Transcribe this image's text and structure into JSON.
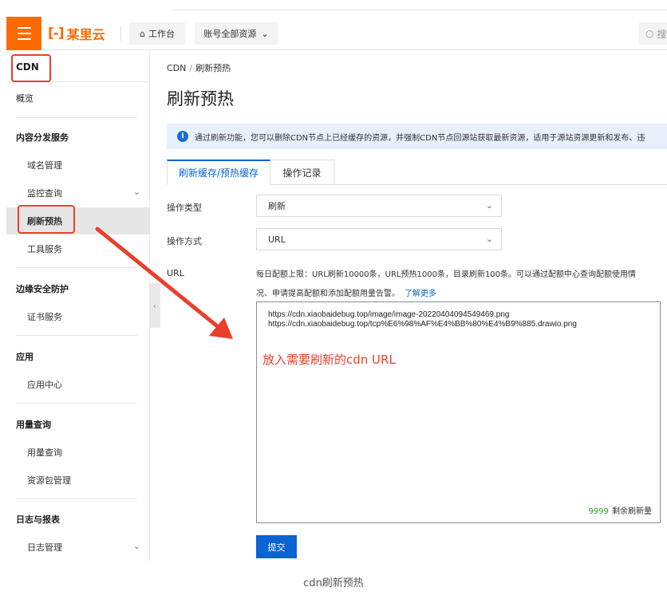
{
  "topbar": {
    "brand": "某里云",
    "brand_mark": "[-]",
    "workspace_label": "工作台",
    "resource_label": "账号全部资源",
    "search_placeholder": "搜"
  },
  "sidebar": {
    "title": "CDN",
    "overview": "概览",
    "groups": [
      {
        "label": "内容分发服务",
        "items": [
          "域名管理",
          "监控查询",
          "刷新预热",
          "工具服务"
        ]
      },
      {
        "label": "边缘安全防护",
        "items": [
          "证书服务"
        ]
      },
      {
        "label": "应用",
        "items": [
          "应用中心"
        ]
      },
      {
        "label": "用量查询",
        "items": [
          "用量查询",
          "资源包管理"
        ]
      },
      {
        "label": "日志与报表",
        "items": [
          "日志管理"
        ]
      }
    ]
  },
  "breadcrumb": {
    "root": "CDN",
    "separator": "/",
    "current": "刷新预热"
  },
  "page_title": "刷新预热",
  "notice": "通过刷新功能，您可以删除CDN节点上已经缓存的资源，并强制CDN节点回源站获取最新资源，适用于源站资源更新和发布、违",
  "tabs": [
    {
      "label": "刷新缓存/预热缓存",
      "active": true
    },
    {
      "label": "操作记录",
      "active": false
    }
  ],
  "form": {
    "op_type_label": "操作类型",
    "op_type_value": "刷新",
    "op_method_label": "操作方式",
    "op_method_value": "URL",
    "url_label": "URL",
    "hint_line1": "每日配额上限：URL刷新10000条，URL预热1000条，目录刷新100条。可以通过配额中心查询配额使用情",
    "hint_line2": "况、申请提高配额和添加配额用量告警。",
    "hint_link": "了解更多",
    "urls": [
      "https://cdn.xiaobaidebug.top/image/image-20220404094549469.png",
      "https://cdn.xiaobaidebug.top/tcp%E6%98%AF%E4%BB%80%E4%B9%885.drawio.png"
    ],
    "annotation": "放入需要刷新的cdn URL",
    "remaining_count": "9999",
    "remaining_label": "剩余刷新量",
    "submit_label": "提交"
  },
  "caption": "cdn刷新预热",
  "colors": {
    "brand": "#ff6a00",
    "primary": "#0a64d2",
    "annotation": "#e8402a",
    "counter": "#2ea121"
  }
}
